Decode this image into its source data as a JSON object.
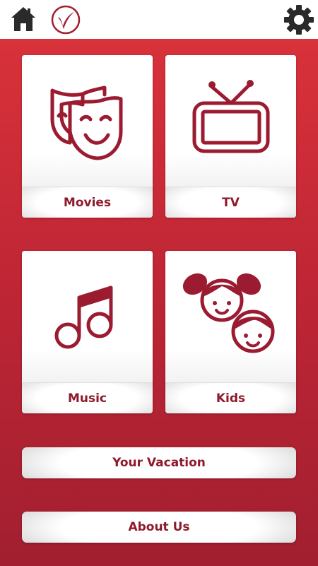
{
  "header": {
    "home_icon": "home-icon",
    "logo_icon": "brand-logo-icon",
    "settings_icon": "gear-icon"
  },
  "colors": {
    "accent": "#9b1b30",
    "background_top": "#d8323a",
    "background_bottom": "#a11f30",
    "label_text": "#8e1a2b"
  },
  "tiles": [
    {
      "label": "Movies",
      "icon": "theater-masks-icon"
    },
    {
      "label": "TV",
      "icon": "television-icon"
    },
    {
      "label": "Music",
      "icon": "music-note-icon"
    },
    {
      "label": "Kids",
      "icon": "kids-faces-icon"
    }
  ],
  "buttons": {
    "vacation": "Your Vacation",
    "about": "About Us"
  }
}
